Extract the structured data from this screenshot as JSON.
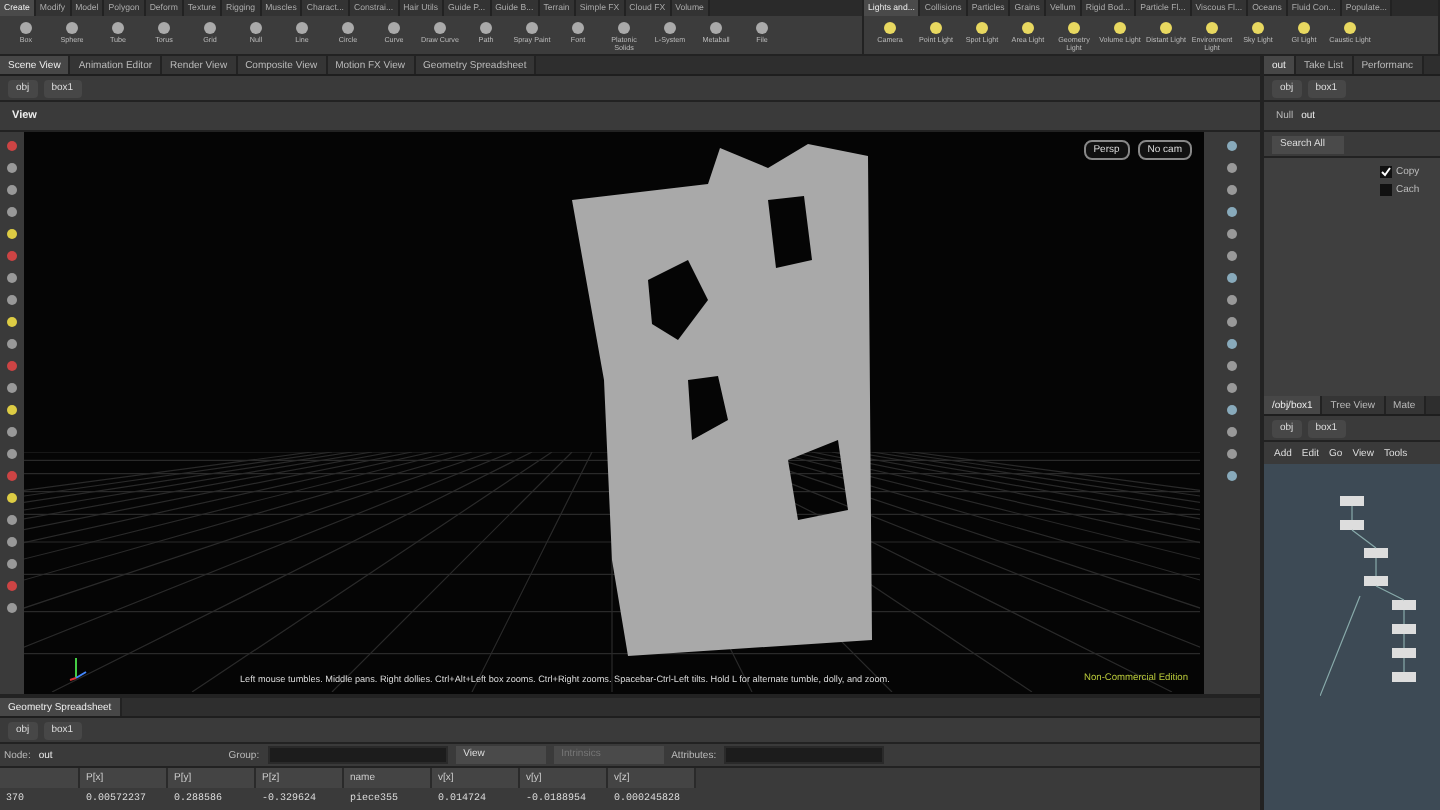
{
  "shelf_left": {
    "tabs": [
      {
        "label": "Create",
        "selected": true
      },
      {
        "label": "Modify",
        "selected": false
      },
      {
        "label": "Model",
        "selected": false
      },
      {
        "label": "Polygon",
        "selected": false
      },
      {
        "label": "Deform",
        "selected": false
      },
      {
        "label": "Texture",
        "selected": false
      },
      {
        "label": "Rigging",
        "selected": false
      },
      {
        "label": "Muscles",
        "selected": false
      },
      {
        "label": "Charact...",
        "selected": false
      },
      {
        "label": "Constrai...",
        "selected": false
      },
      {
        "label": "Hair Utils",
        "selected": false
      },
      {
        "label": "Guide P...",
        "selected": false
      },
      {
        "label": "Guide B...",
        "selected": false
      },
      {
        "label": "Terrain",
        "selected": false
      },
      {
        "label": "Simple FX",
        "selected": false
      },
      {
        "label": "Cloud FX",
        "selected": false
      },
      {
        "label": "Volume",
        "selected": false
      }
    ],
    "tools": [
      "Box",
      "Sphere",
      "Tube",
      "Torus",
      "Grid",
      "Null",
      "Line",
      "Circle",
      "Curve",
      "Draw Curve",
      "Path",
      "Spray Paint",
      "Font",
      "Platonic Solids",
      "L-System",
      "Metaball",
      "File"
    ]
  },
  "shelf_right": {
    "tabs": [
      {
        "label": "Lights and...",
        "selected": true
      },
      {
        "label": "Collisions",
        "selected": false
      },
      {
        "label": "Particles",
        "selected": false
      },
      {
        "label": "Grains",
        "selected": false
      },
      {
        "label": "Vellum",
        "selected": false
      },
      {
        "label": "Rigid Bod...",
        "selected": false
      },
      {
        "label": "Particle Fl...",
        "selected": false
      },
      {
        "label": "Viscous Fl...",
        "selected": false
      },
      {
        "label": "Oceans",
        "selected": false
      },
      {
        "label": "Fluid Con...",
        "selected": false
      },
      {
        "label": "Populate...",
        "selected": false
      }
    ],
    "tools": [
      "Camera",
      "Point Light",
      "Spot Light",
      "Area Light",
      "Geometry Light",
      "Volume Light",
      "Distant Light",
      "Environment Light",
      "Sky Light",
      "GI Light",
      "Caustic Light"
    ]
  },
  "scene_pane": {
    "tabs": [
      {
        "label": "Scene View",
        "selected": true
      },
      {
        "label": "Animation Editor",
        "selected": false
      },
      {
        "label": "Render View",
        "selected": false
      },
      {
        "label": "Composite View",
        "selected": false
      },
      {
        "label": "Motion FX View",
        "selected": false
      },
      {
        "label": "Geometry Spreadsheet",
        "selected": false
      }
    ],
    "path": [
      "obj",
      "box1"
    ],
    "title": "View",
    "camera_menus": [
      "Persp",
      "No cam"
    ],
    "status_text": "Left mouse tumbles. Middle pans. Right dollies. Ctrl+Alt+Left box zooms. Ctrl+Right zooms. Spacebar-Ctrl-Left tilts. Hold L for alternate tumble, dolly, and zoom.",
    "edition": "Non-Commercial Edition"
  },
  "spreadsheet": {
    "tabs": [
      {
        "label": "Geometry Spreadsheet",
        "selected": true
      }
    ],
    "path": [
      "obj",
      "box1"
    ],
    "node_label": "Node:",
    "node_value": "out",
    "group_label": "Group:",
    "view_menu": "View",
    "intrinsics": "Intrinsics",
    "attributes_label": "Attributes:",
    "columns": [
      "",
      "P[x]",
      "P[y]",
      "P[z]",
      "name",
      "v[x]",
      "v[y]",
      "v[z]"
    ],
    "rows": [
      [
        "370",
        "0.00572237",
        "0.288586",
        "-0.329624",
        "piece355",
        "0.014724",
        "-0.0188954",
        "0.000245828"
      ]
    ]
  },
  "parm_pane": {
    "tabs": [
      {
        "label": "out",
        "selected": true
      },
      {
        "label": "Take List",
        "selected": false
      },
      {
        "label": "Performanc",
        "selected": false
      }
    ],
    "path": [
      "obj",
      "box1"
    ],
    "node_type": "Null",
    "node_name": "out",
    "search": "Search All",
    "checkboxes": [
      {
        "label": "Copy",
        "checked": true
      },
      {
        "label": "Cach",
        "checked": false
      }
    ]
  },
  "network_pane": {
    "tabs": [
      {
        "label": "/obj/box1",
        "selected": true
      },
      {
        "label": "Tree View",
        "selected": false
      },
      {
        "label": "Mate",
        "selected": false
      }
    ],
    "path": [
      "obj",
      "box1"
    ],
    "menu": [
      "Add",
      "Edit",
      "Go",
      "View",
      "Tools"
    ]
  }
}
